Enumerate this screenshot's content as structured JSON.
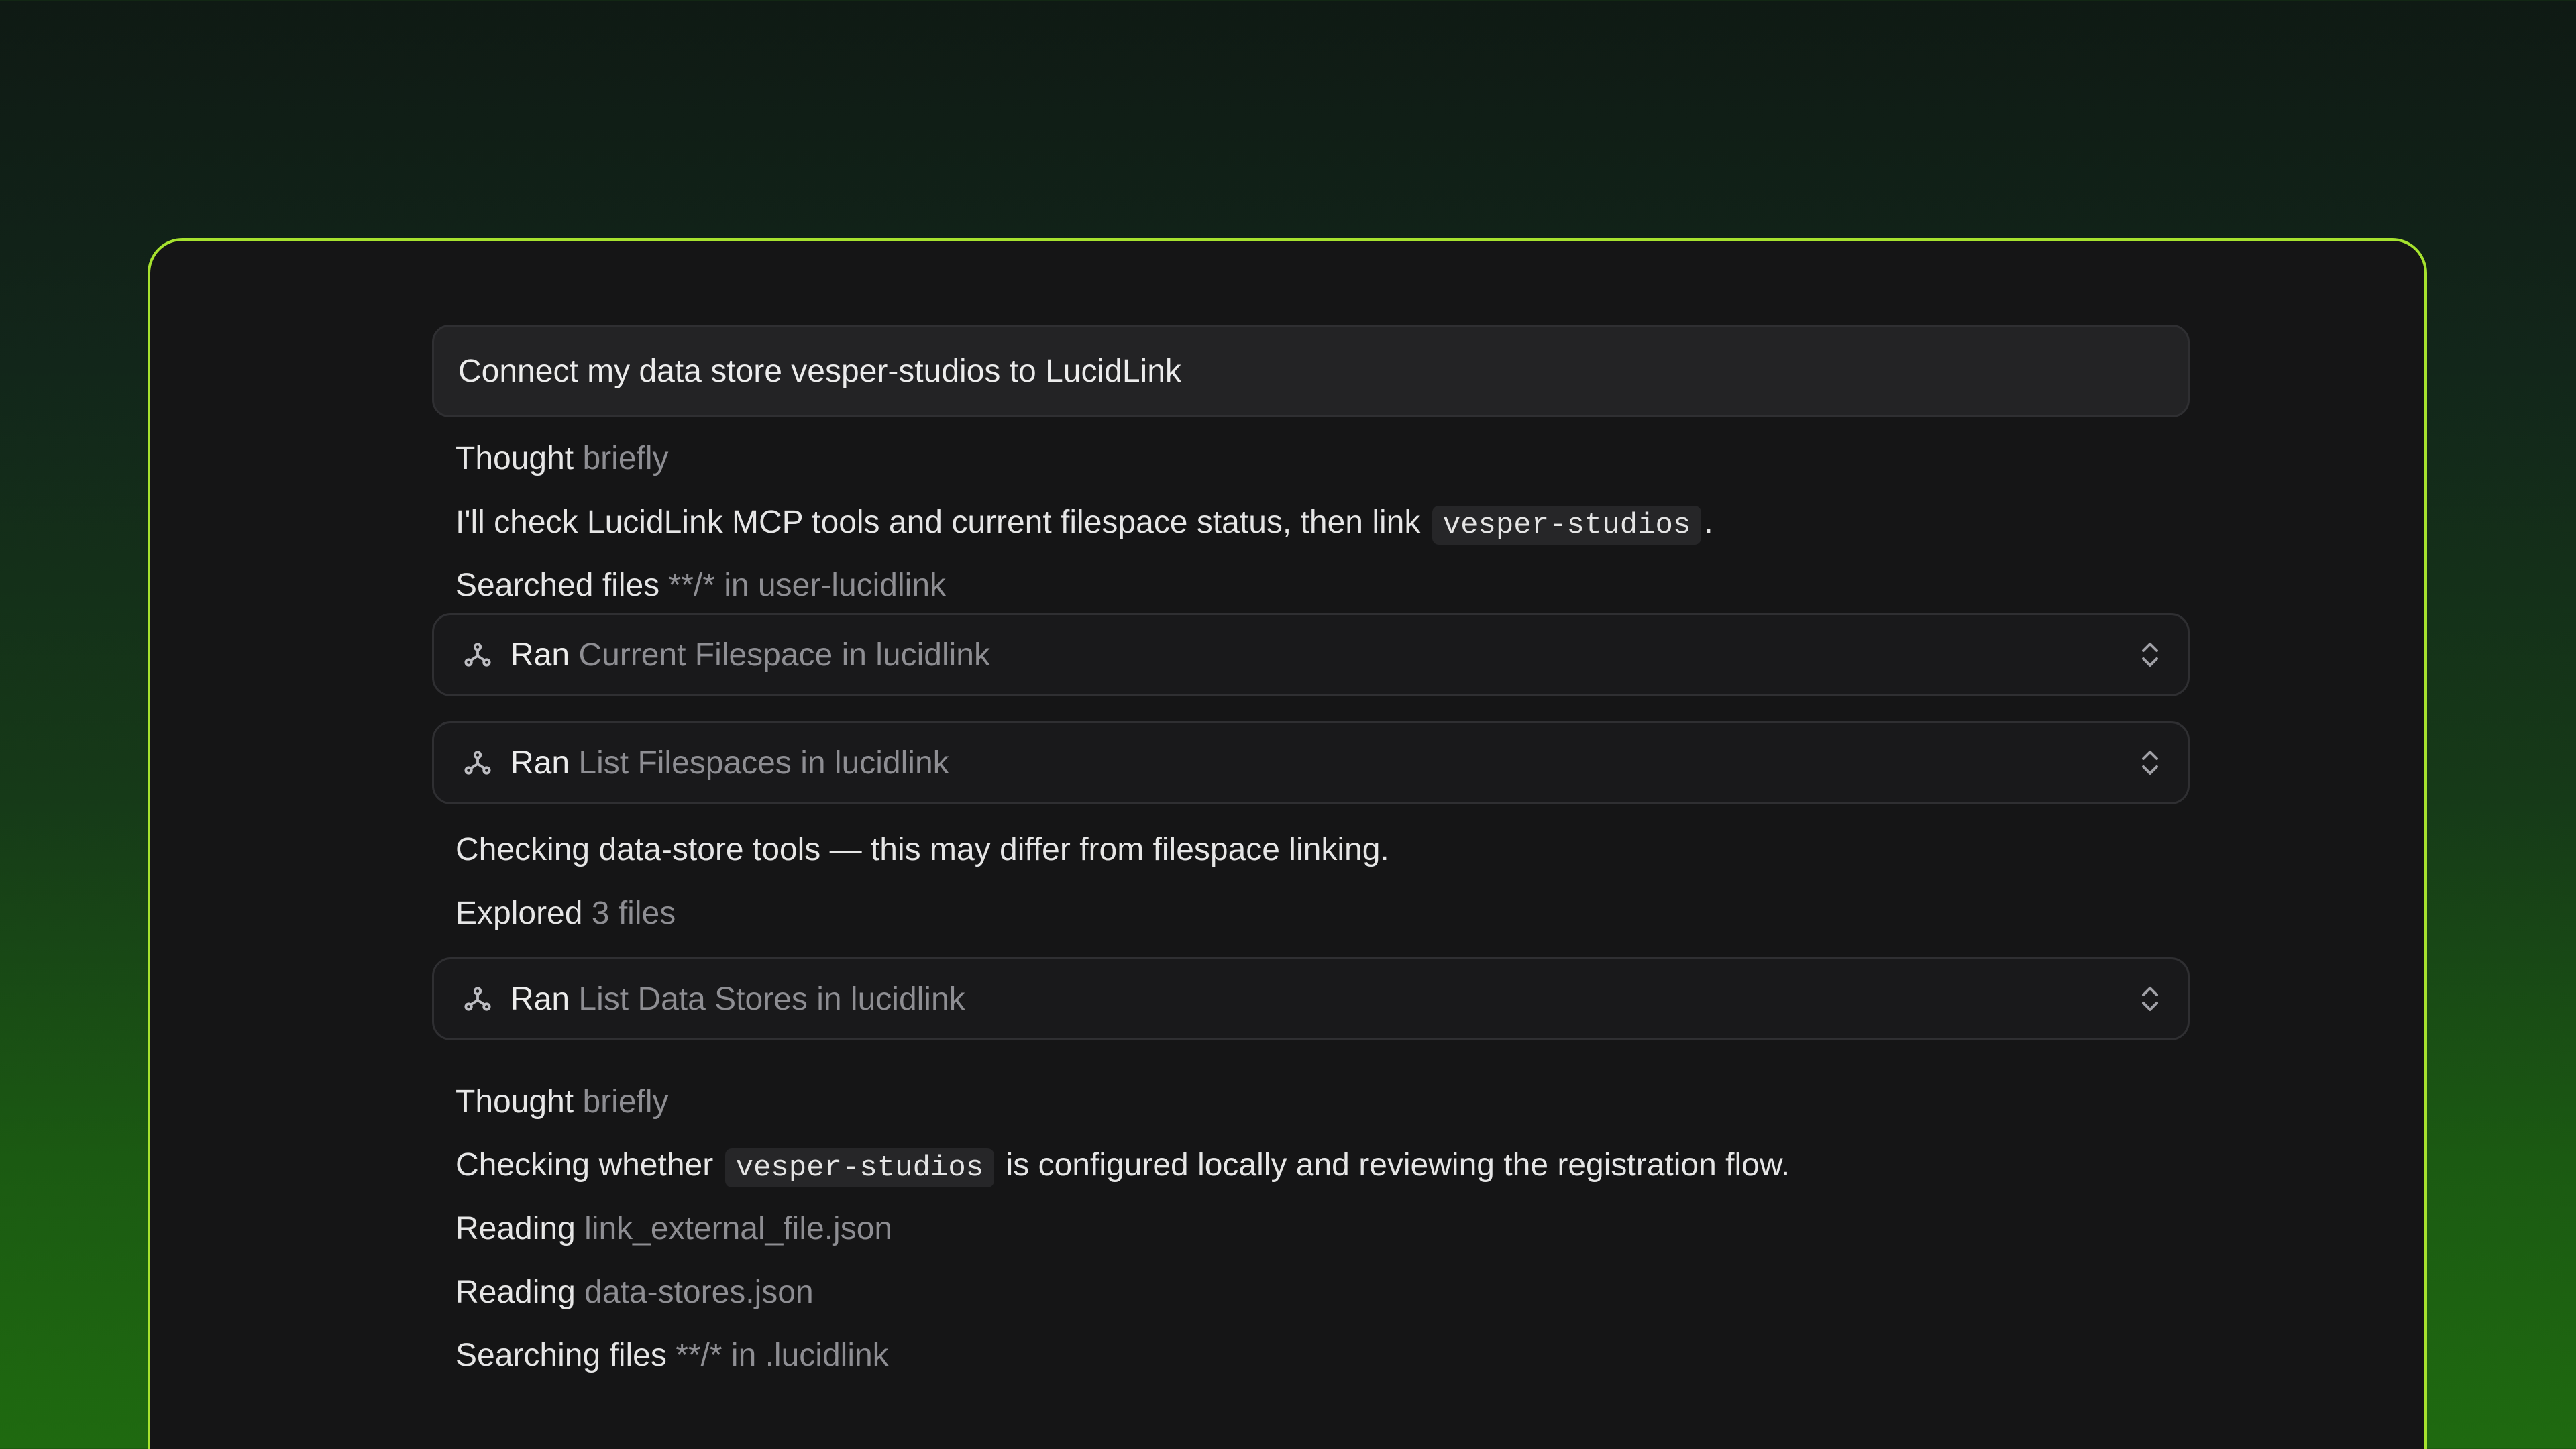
{
  "prompt": {
    "text": "Connect my data store vesper-studios to LucidLink"
  },
  "thread": {
    "thought_1": {
      "label": "Thought",
      "detail": "briefly"
    },
    "message_1": {
      "before": "I'll check LucidLink MCP tools and current filespace status, then link",
      "code": "vesper-studios",
      "after": "."
    },
    "searched_1": {
      "verb": "Searched files",
      "detail": "**/* in user-lucidlink"
    },
    "tool_1": {
      "verb": "Ran",
      "name": "Current Filespace in lucidlink"
    },
    "tool_2": {
      "verb": "Ran",
      "name": "List Filespaces in lucidlink"
    },
    "message_2": {
      "text": "Checking data-store tools — this may differ from filespace linking."
    },
    "explored_1": {
      "verb": "Explored",
      "detail": "3 files"
    },
    "tool_3": {
      "verb": "Ran",
      "name": "List Data Stores in lucidlink"
    },
    "thought_2": {
      "label": "Thought",
      "detail": "briefly"
    },
    "message_3": {
      "before": "Checking whether",
      "code": "vesper-studios",
      "after": "is configured locally and reviewing the registration flow."
    },
    "reading_1": {
      "verb": "Reading",
      "detail": "link_external_file.json"
    },
    "reading_2": {
      "verb": "Reading",
      "detail": "data-stores.json"
    },
    "searching_1": {
      "verb": "Searching files",
      "detail": "**/* in .lucidlink"
    }
  },
  "icons": {
    "tool": "mcp-tool-icon",
    "expand": "chevron-up-down-icon"
  },
  "colors": {
    "accent_border": "#a6e22e",
    "window_bg": "#151516",
    "muted_text": "#8e8e93"
  }
}
